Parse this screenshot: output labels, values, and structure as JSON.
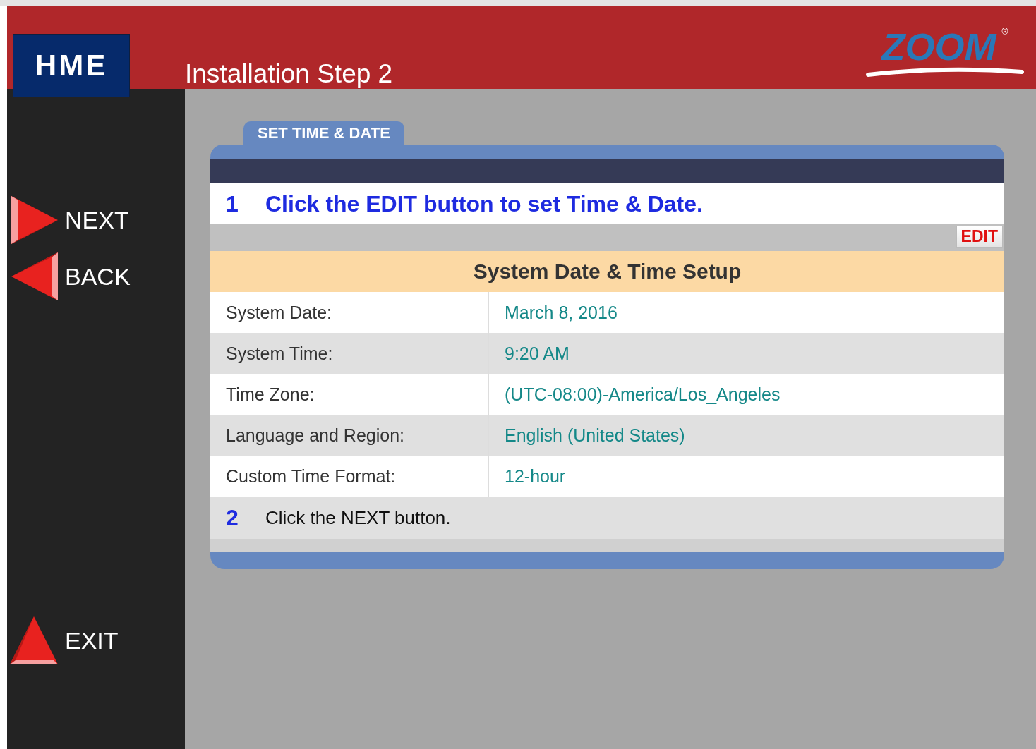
{
  "header": {
    "brand": "HME",
    "title": "Installation Step 2",
    "logo": "ZOOM",
    "logo_mark": "®"
  },
  "nav": [
    {
      "kind": "next",
      "label": "NEXT"
    },
    {
      "kind": "back",
      "label": "BACK"
    },
    {
      "kind": "exit",
      "label": "EXIT"
    }
  ],
  "panel": {
    "tab": "SET TIME & DATE",
    "step_1": {
      "number": "1",
      "text": "Click the EDIT button to set Time & Date."
    },
    "edit_button": "EDIT",
    "table": {
      "title": "System Date & Time Setup",
      "rows": [
        {
          "label": "System Date:",
          "value": "March 8, 2016"
        },
        {
          "label": "System Time:",
          "value": "9:20 AM"
        },
        {
          "label": "Time Zone:",
          "value": "(UTC-08:00)-America/Los_Angeles"
        },
        {
          "label": "Language and Region:",
          "value": "English (United States)"
        },
        {
          "label": "Custom Time Format:",
          "value": "12-hour"
        }
      ]
    },
    "step_2": {
      "number": "2",
      "text": "Click the NEXT button."
    }
  }
}
